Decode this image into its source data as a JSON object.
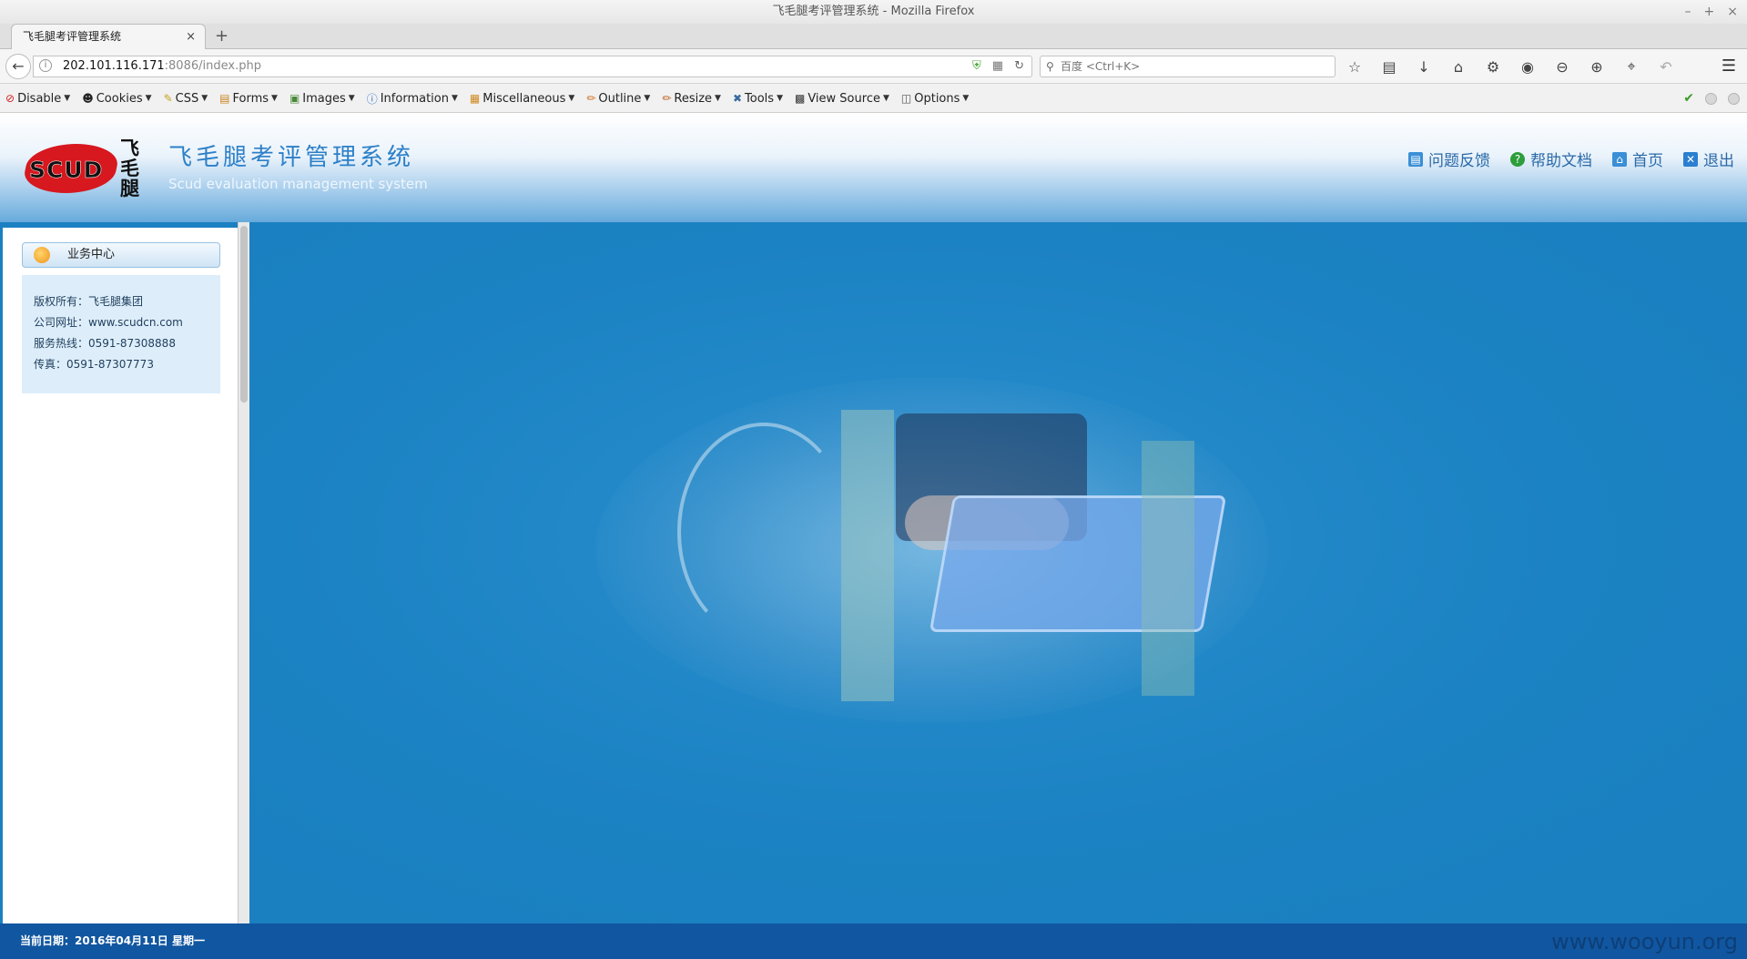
{
  "window": {
    "title": "飞毛腿考评管理系统 - Mozilla Firefox",
    "controls": [
      "–",
      "+",
      "×"
    ]
  },
  "tab": {
    "title": "飞毛腿考评管理系统",
    "close": "×",
    "new_tab": "+"
  },
  "nav": {
    "url_host": "202.101.116.171",
    "url_path": ":8086/index.php",
    "search_placeholder": "百度 <Ctrl+K>"
  },
  "devbar": {
    "items": [
      {
        "icon": "disable-icon",
        "label": "Disable"
      },
      {
        "icon": "cookies-icon",
        "label": "Cookies"
      },
      {
        "icon": "css-icon",
        "label": "CSS"
      },
      {
        "icon": "forms-icon",
        "label": "Forms"
      },
      {
        "icon": "images-icon",
        "label": "Images"
      },
      {
        "icon": "information-icon",
        "label": "Information"
      },
      {
        "icon": "miscellaneous-icon",
        "label": "Miscellaneous"
      },
      {
        "icon": "outline-icon",
        "label": "Outline"
      },
      {
        "icon": "resize-icon",
        "label": "Resize"
      },
      {
        "icon": "tools-icon",
        "label": "Tools"
      },
      {
        "icon": "view-source-icon",
        "label": "View Source"
      },
      {
        "icon": "options-icon",
        "label": "Options"
      }
    ]
  },
  "header": {
    "logo_text": "SCUD",
    "logo_cn": "飞毛腿",
    "title": "飞毛腿考评管理系统",
    "subtitle": "Scud evaluation management system",
    "links": {
      "feedback": "问题反馈",
      "help": "帮助文档",
      "home": "首页",
      "logout": "退出"
    }
  },
  "sidebar": {
    "heading": "业务中心",
    "info": {
      "copyright": "版权所有：飞毛腿集团",
      "website": "公司网址：www.scudcn.com",
      "hotline": "服务热线：0591-87308888",
      "fax": "传真：0591-87307773"
    }
  },
  "footer": {
    "date": "当前日期：2016年04月11日 星期一",
    "watermark": "www.wooyun.org"
  },
  "colors": {
    "page_blue": "#1a80c1",
    "footer_blue": "#1156a0",
    "logo_red": "#d7181f",
    "title_blue": "#2d80c8"
  }
}
